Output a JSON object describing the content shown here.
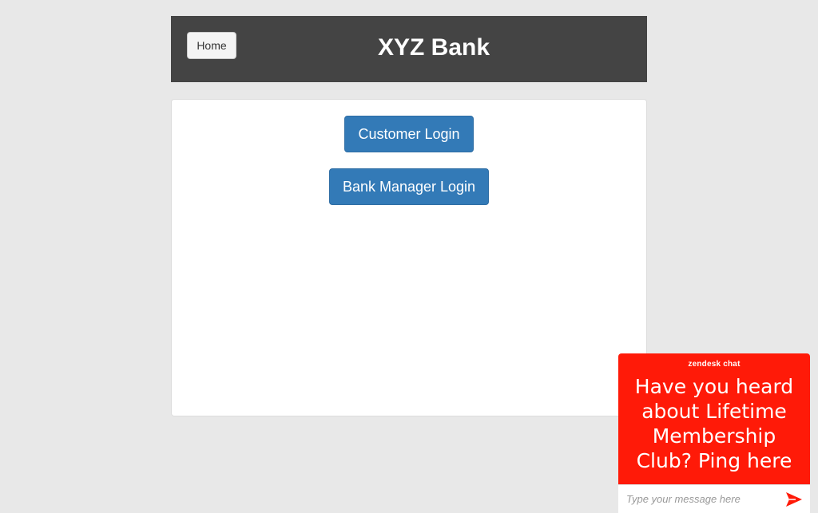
{
  "header": {
    "home_label": "Home",
    "title": "XYZ Bank",
    "background": "#444444"
  },
  "login_panel": {
    "customer_login_label": "Customer Login",
    "manager_login_label": "Bank Manager Login",
    "button_color": "#337ab7"
  },
  "chat_widget": {
    "brand": "zendesk chat",
    "message": "Have you heard about Lifetime Membership Club? Ping here",
    "input_placeholder": "Type your message here",
    "send_icon": "send-arrow-icon",
    "accent_color": "#ff1a08"
  }
}
